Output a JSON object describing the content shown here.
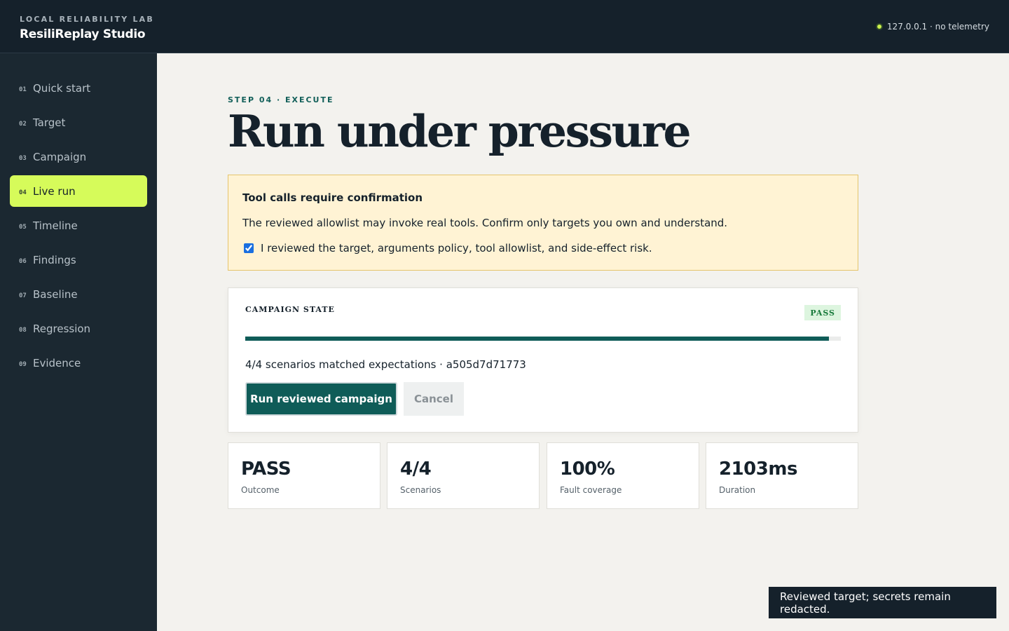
{
  "header": {
    "eyebrow": "LOCAL RELIABILITY LAB",
    "title": "ResiliReplay Studio",
    "host_status": "127.0.0.1 · no telemetry"
  },
  "sidebar": {
    "items": [
      {
        "num": "01",
        "label": "Quick start"
      },
      {
        "num": "02",
        "label": "Target"
      },
      {
        "num": "03",
        "label": "Campaign"
      },
      {
        "num": "04",
        "label": "Live run",
        "active": true
      },
      {
        "num": "05",
        "label": "Timeline"
      },
      {
        "num": "06",
        "label": "Findings"
      },
      {
        "num": "07",
        "label": "Baseline"
      },
      {
        "num": "08",
        "label": "Regression"
      },
      {
        "num": "09",
        "label": "Evidence"
      }
    ]
  },
  "main": {
    "eyebrow": "STEP 04 · EXECUTE",
    "title": "Run under pressure",
    "warning": {
      "title": "Tool calls require confirmation",
      "text": "The reviewed allowlist may invoke real tools. Confirm only targets you own and understand.",
      "checkbox_label": "I reviewed the target, arguments policy, tool allowlist, and side-effect risk.",
      "checked": true
    },
    "campaign": {
      "label": "CAMPAIGN STATE",
      "badge": "PASS",
      "progress": 0.98,
      "summary": "4/4 scenarios matched expectations · a505d7d71773",
      "run_label": "Run reviewed campaign",
      "cancel_label": "Cancel"
    },
    "metrics": [
      {
        "value": "PASS",
        "label": "Outcome"
      },
      {
        "value": "4/4",
        "label": "Scenarios"
      },
      {
        "value": "100%",
        "label": "Fault coverage"
      },
      {
        "value": "2103ms",
        "label": "Duration"
      }
    ]
  },
  "toast": "Reviewed target; secrets remain redacted.",
  "colors": {
    "accent": "#0f5c58",
    "active_nav": "#d6fb5a",
    "pass_badge_bg": "#ddf5df",
    "warning_bg": "#fff3d4"
  }
}
